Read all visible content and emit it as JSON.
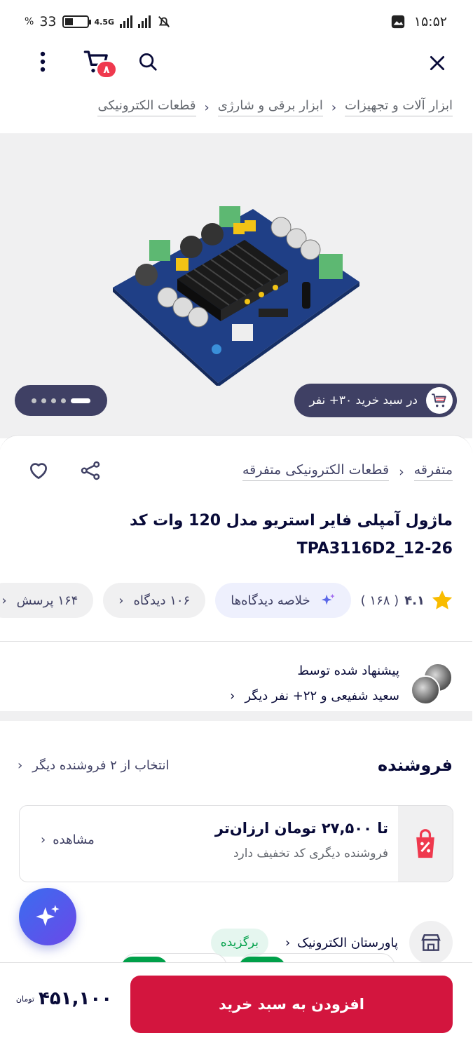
{
  "status_bar": {
    "time": "۱۵:۵۲",
    "battery": "33",
    "percent": "%",
    "network": "4.5G"
  },
  "top_bar": {
    "cart_count": "۸"
  },
  "breadcrumb": [
    "ابزار آلات و تجهیزات",
    "ابزار برقی و شارژی",
    "قطعات الکترونیکی"
  ],
  "gallery": {
    "in_cart_text": "در سبد خرید ۳۰+ نفر"
  },
  "product": {
    "category_path": [
      "متفرقه",
      "قطعات الکترونیکی متفرقه"
    ],
    "title_line1": "ماژول آمپلی فایر استریو مدل 120 وات کد",
    "title_line2": "TPA3116D2_12-26",
    "rating": "۴.۱",
    "rating_count": "( ۱۶۸ )",
    "summary_label": "خلاصه دیدگاه‌ها",
    "reviews_label": "۱۰۶ دیدگاه",
    "questions_label": "۱۶۴ پرسش"
  },
  "recommendation": {
    "title": "پیشنهاد شده توسط",
    "subtitle": "سعید شفیعی و ۲۲+ نفر دیگر"
  },
  "seller": {
    "title": "فروشنده",
    "other_sellers": "انتخاب از ۲ فروشنده دیگر",
    "offer_title": "تا ۲۷,۵۰۰ تومان ارزان‌تر",
    "offer_subtitle": "فروشنده دیگری کد تخفیف دارد",
    "offer_view": "مشاهده",
    "store_name": "پاورستان الکترونیک",
    "store_badge": "برگزیده"
  },
  "bottom_bar": {
    "add_to_cart": "افزودن به سبد خرید",
    "price": "۴۵۱,۱۰۰",
    "currency": "تومان"
  },
  "colors": {
    "brand_red": "#d3153e",
    "badge_red": "#ef394e",
    "dark_pill": "#3f4064",
    "success_green": "#00a049",
    "star_gold": "#f9bc00"
  }
}
